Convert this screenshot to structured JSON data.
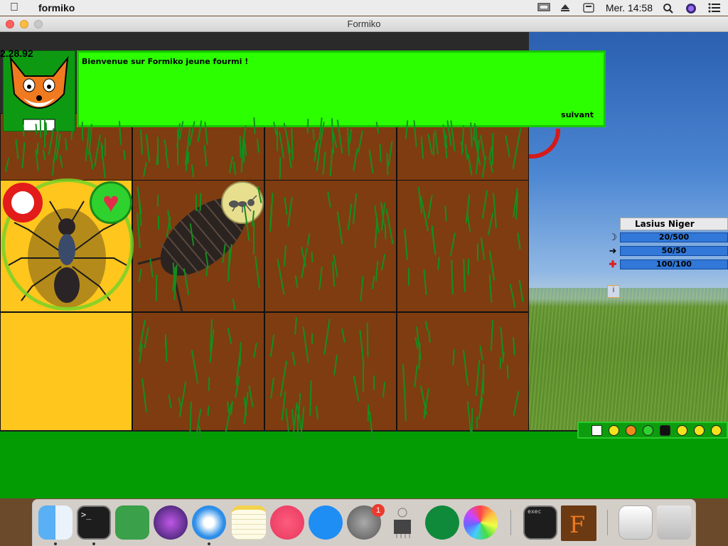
{
  "menubar": {
    "app_name": "formiko",
    "clock": "Mer. 14:58"
  },
  "window": {
    "title": "Formiko"
  },
  "game": {
    "version": "2.28.92",
    "dialog_message": "Bienvenue sur Formiko jeune fourmi !",
    "dialog_next": "suivant",
    "species_name": "Lasius Niger",
    "stats": [
      {
        "icon": "food-icon",
        "value": "20/500"
      },
      {
        "icon": "arrow-icon",
        "value": "50/50"
      },
      {
        "icon": "health-icon",
        "value": "100/100"
      }
    ],
    "info_button": "i"
  },
  "dock": {
    "notification_count": "1",
    "terminal_label": "exec"
  }
}
